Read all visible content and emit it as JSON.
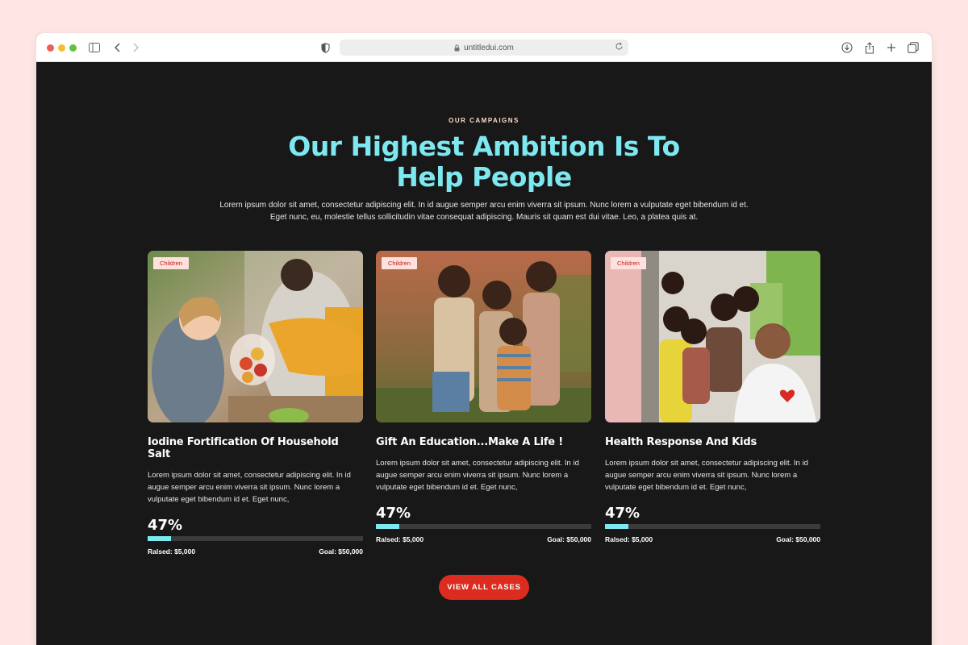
{
  "browser": {
    "url": "untitledui.com"
  },
  "section": {
    "eyebrow": "OUR CAMPAIGNS",
    "headline_line1": "Our Highest Ambition Is To",
    "headline_line2": "Help People",
    "intro_line1": "Lorem ipsum dolor sit amet, consectetur adipiscing elit. In id augue semper arcu enim viverra sit ipsum. Nunc lorem a vulputate eget bibendum id et.",
    "intro_line2": "Eget nunc, eu, molestie tellus sollicitudin vitae consequat adipiscing. Mauris sit quam est dui vitae. Leo, a platea quis at."
  },
  "campaigns": [
    {
      "badge": "Children",
      "title": "Iodine Fortification Of Household Salt",
      "text": "Lorem ipsum dolor sit amet, consectetur adipiscing elit. In id augue semper arcu enim viverra sit ipsum. Nunc lorem a vulputate eget bibendum id et. Eget nunc,",
      "percent": "47%",
      "progress": 0.11,
      "raised": "Ralsed: $5,000",
      "goal": "Goal: $50,000"
    },
    {
      "badge": "Children",
      "title": "Gift An Education...Make A Life !",
      "text": "Lorem ipsum dolor sit amet, consectetur adipiscing elit. In id augue semper arcu enim viverra sit ipsum. Nunc lorem a vulputate eget bibendum id et. Eget nunc,",
      "percent": "47%",
      "progress": 0.11,
      "raised": "Ralsed: $5,000",
      "goal": "Goal: $50,000"
    },
    {
      "badge": "Children",
      "title": "Health Response And Kids",
      "text": "Lorem ipsum dolor sit amet, consectetur adipiscing elit. In id augue semper arcu enim viverra sit ipsum. Nunc lorem a vulputate eget bibendum id et. Eget nunc,",
      "percent": "47%",
      "progress": 0.11,
      "raised": "Ralsed: $5,000",
      "goal": "Goal: $50,000"
    }
  ],
  "cta": {
    "label": "VIEW ALL CASES"
  },
  "colors": {
    "accent": "#7ee8f0",
    "cta": "#dc2c20",
    "badge_bg": "#fde1de",
    "badge_text": "#c4211a",
    "page_bg": "#181818"
  }
}
